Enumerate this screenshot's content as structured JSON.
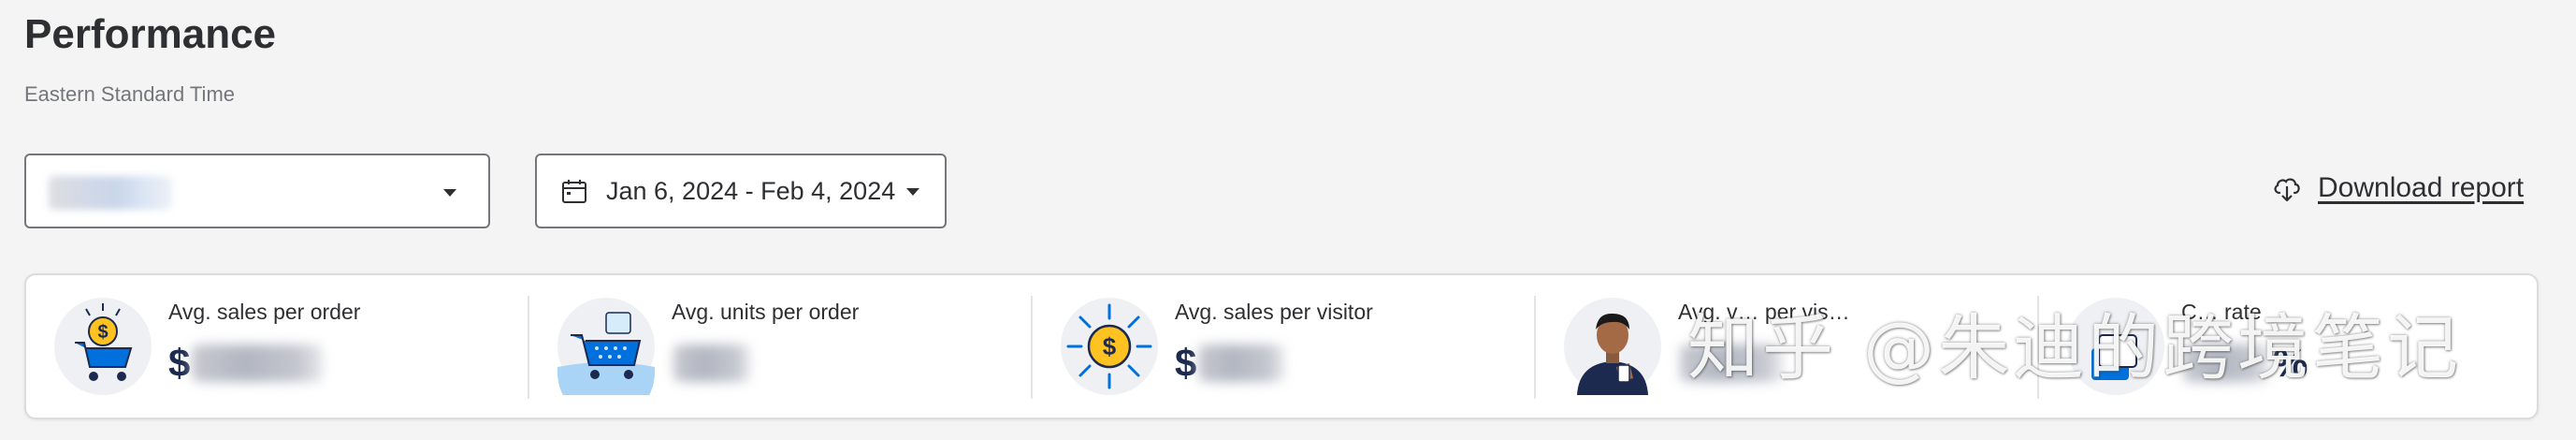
{
  "header": {
    "title": "Performance",
    "subtitle": "Eastern Standard Time"
  },
  "filters": {
    "store_select": {
      "value": ""
    },
    "date_range": {
      "label": "Jan 6, 2024 - Feb 4, 2024"
    }
  },
  "actions": {
    "download_label": "Download report"
  },
  "metrics": [
    {
      "label": "Avg. sales per order",
      "prefix": "$",
      "suffix": "",
      "icon": "cart-coin-icon"
    },
    {
      "label": "Avg. units per order",
      "prefix": "",
      "suffix": "",
      "icon": "cart-box-icon"
    },
    {
      "label": "Avg. sales per visitor",
      "prefix": "$",
      "suffix": "",
      "icon": "coin-sun-icon"
    },
    {
      "label": "Avg. v… per vis…",
      "prefix": "",
      "suffix": "",
      "icon": "person-phone-icon"
    },
    {
      "label": "C… rate",
      "prefix": "",
      "suffix": "%",
      "icon": "conversion-icon"
    }
  ],
  "watermark": "知乎 @朱迪的跨境笔记",
  "colors": {
    "background": "#f4f4f4",
    "navy": "#1c2a4f",
    "walmart_blue": "#0071dc",
    "spark_yellow": "#ffc220"
  }
}
